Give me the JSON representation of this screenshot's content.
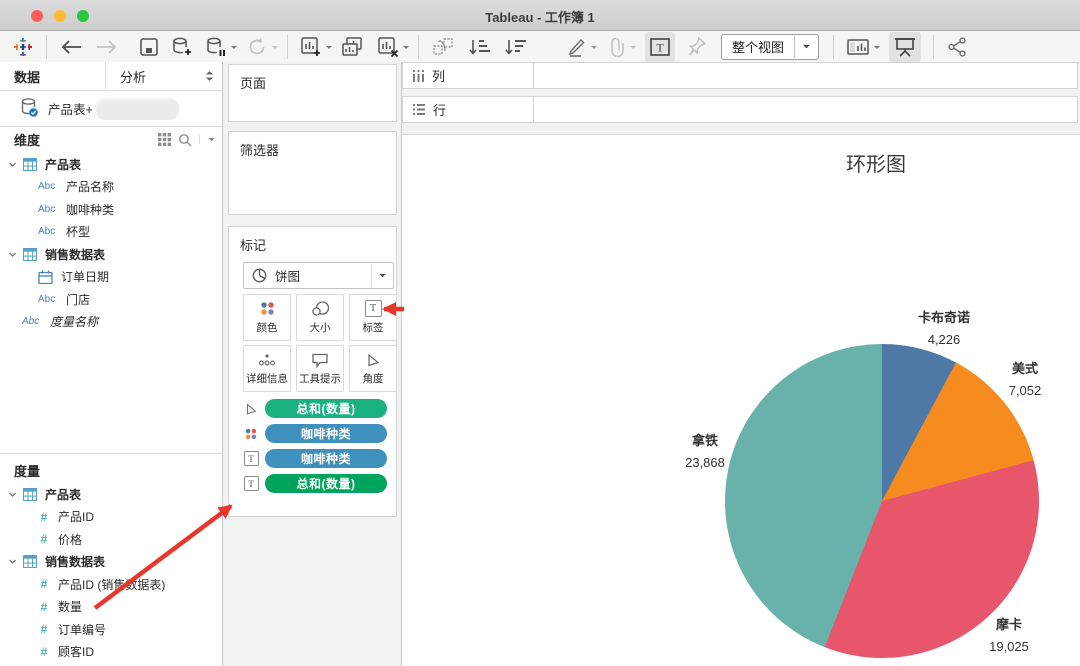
{
  "window": {
    "title": "Tableau - 工作簿 1"
  },
  "toolbar": {
    "fit_label": "整个视图"
  },
  "icons": {
    "abc": "Abc",
    "hash": "#",
    "t": "T"
  },
  "sidebar": {
    "tabs": {
      "data": "数据",
      "analytics": "分析"
    },
    "datasource_label": "产品表+ (",
    "dimensions_header": "维度",
    "measures_header": "度量",
    "dimension_items": [
      {
        "type": "group",
        "icon": "table",
        "label": "产品表"
      },
      {
        "type": "child",
        "icon": "abc",
        "label": "产品名称"
      },
      {
        "type": "child",
        "icon": "abc",
        "label": "咖啡种类"
      },
      {
        "type": "child",
        "icon": "abc",
        "label": "杯型"
      },
      {
        "type": "group",
        "icon": "table",
        "label": "销售数据表"
      },
      {
        "type": "child",
        "icon": "date",
        "label": "订单日期"
      },
      {
        "type": "child",
        "icon": "abc",
        "label": "门店"
      },
      {
        "type": "special",
        "icon": "abc",
        "label": "度量名称"
      }
    ],
    "measure_items": [
      {
        "type": "group",
        "icon": "table",
        "label": "产品表"
      },
      {
        "type": "child",
        "icon": "hash",
        "label": "产品ID"
      },
      {
        "type": "child",
        "icon": "hash",
        "label": "价格"
      },
      {
        "type": "group",
        "icon": "table",
        "label": "销售数据表"
      },
      {
        "type": "child",
        "icon": "hash",
        "label": "产品ID (销售数据表)"
      },
      {
        "type": "child",
        "icon": "hash",
        "label": "数量"
      },
      {
        "type": "child",
        "icon": "hash",
        "label": "订单编号"
      },
      {
        "type": "child",
        "icon": "hash",
        "label": "顾客ID"
      }
    ]
  },
  "cards": {
    "pages_label": "页面",
    "filters_label": "筛选器",
    "marks_label": "标记",
    "mark_type": "饼图",
    "buttons": [
      {
        "label": "颜色"
      },
      {
        "label": "大小"
      },
      {
        "label": "标签"
      },
      {
        "label": "详细信息"
      },
      {
        "label": "工具提示"
      },
      {
        "label": "角度"
      }
    ],
    "pills": [
      {
        "icon": "angle",
        "label": "总和(数量)",
        "color": "#1cb180"
      },
      {
        "icon": "color",
        "label": "咖啡种类",
        "color": "#4090bd"
      },
      {
        "icon": "text",
        "label": "咖啡种类",
        "color": "#4090bd"
      },
      {
        "icon": "text",
        "label": "总和(数量)",
        "color": "#00a45c"
      }
    ]
  },
  "shelves": {
    "columns_label": "列",
    "rows_label": "行"
  },
  "chart_data": {
    "type": "pie",
    "title": "环形图",
    "categories": [
      "卡布奇诺",
      "美式",
      "摩卡",
      "拿铁"
    ],
    "values": [
      4226,
      7052,
      19025,
      23868
    ],
    "value_labels": [
      "4,226",
      "7,052",
      "19,025",
      "23,868"
    ],
    "colors": [
      "#4e79a7",
      "#f68b1f",
      "#e8566b",
      "#68b2ab"
    ],
    "start_angle_deg": 0,
    "direction": "clockwise",
    "legend": "none",
    "label_style": "category name + total quantity outside slice"
  }
}
